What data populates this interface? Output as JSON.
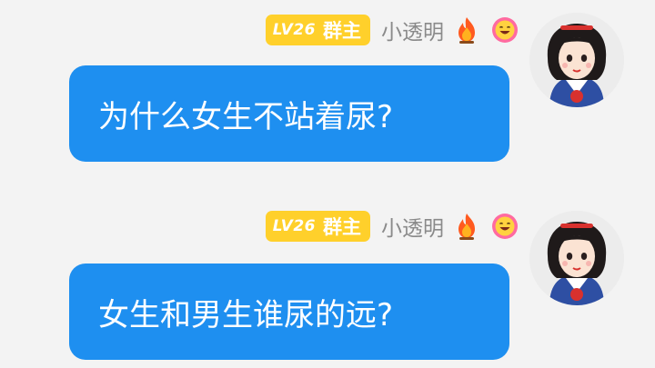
{
  "messages": [
    {
      "level": "LV26",
      "role": "群主",
      "username": "小透明",
      "icons": [
        "fire-icon",
        "laughing-face-icon"
      ],
      "text": "为什么女生不站着尿?"
    },
    {
      "level": "LV26",
      "role": "群主",
      "username": "小透明",
      "icons": [
        "fire-icon",
        "laughing-face-icon"
      ],
      "text": "女生和男生谁尿的远?"
    }
  ],
  "colors": {
    "bubble": "#1e8ff0",
    "badge": "#ffd02b",
    "username": "#8a8a8a",
    "background": "#f3f3f3"
  }
}
